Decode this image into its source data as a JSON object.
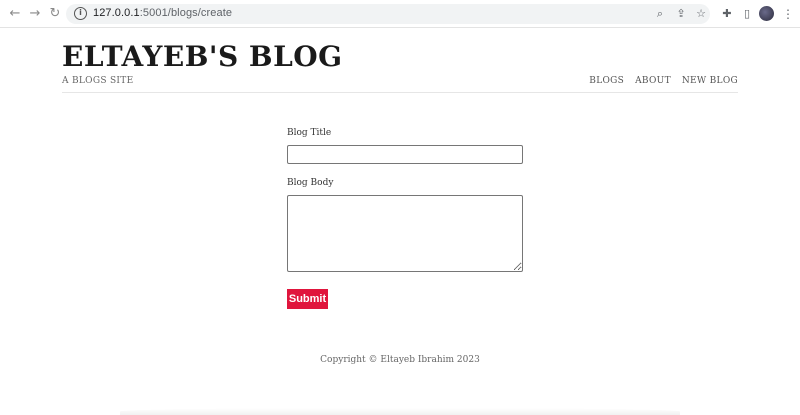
{
  "browser": {
    "url_host": "127.0.0.1",
    "url_rest": ":5001/blogs/create",
    "back_icon": "arrow-left-icon",
    "forward_icon": "arrow-right-icon",
    "reload_icon": "reload-icon"
  },
  "header": {
    "title": "ELTAYEB'S BLOG",
    "tagline": "A BLOGS SITE",
    "nav": [
      "BLOGS",
      "ABOUT",
      "NEW BLOG"
    ]
  },
  "form": {
    "title_label": "Blog Title",
    "title_value": "",
    "body_label": "Blog Body",
    "body_value": "",
    "submit_label": "Submit"
  },
  "footer": {
    "copyright": "Copyright © Eltayeb Ibrahim 2023"
  },
  "colors": {
    "accent": "#e0153d",
    "text": "#222222",
    "muted": "#666666"
  }
}
